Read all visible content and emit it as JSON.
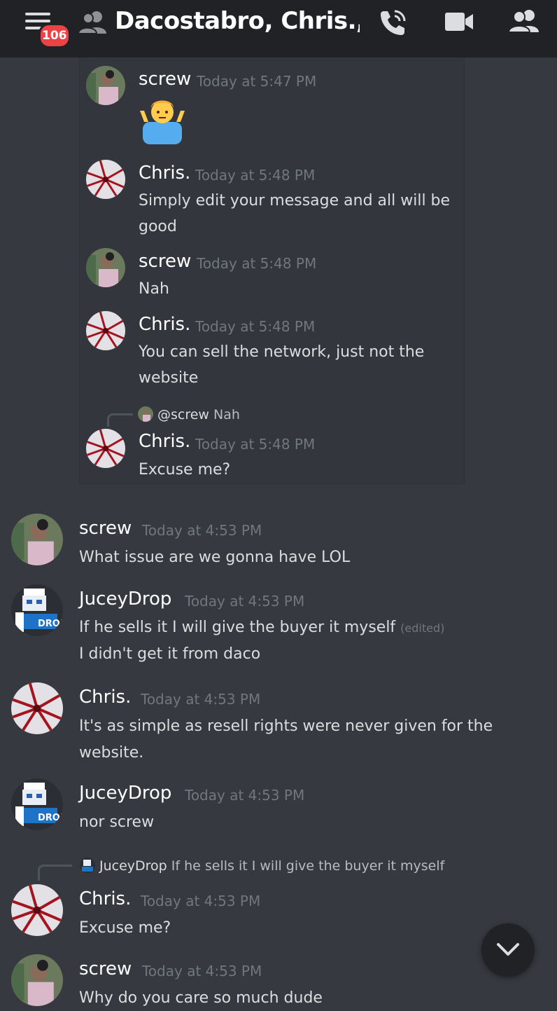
{
  "header": {
    "title": "Dacostabro, Chris.,...",
    "badge_count": "106",
    "icons": [
      "hamburger-menu-icon",
      "dm-group-icon",
      "voice-call-icon",
      "video-call-icon",
      "member-list-icon"
    ]
  },
  "thread_messages": [
    {
      "author": "screw",
      "time": "Today at 5:47 PM",
      "lines": [],
      "emoji": "man-shrugging-emoji"
    },
    {
      "author": "Chris.",
      "time": "Today at 5:48 PM",
      "lines": [
        "Simply edit your message and all will be",
        "good"
      ]
    },
    {
      "author": "screw",
      "time": "Today at 5:48 PM",
      "lines": [
        "Nah"
      ]
    },
    {
      "author": "Chris.",
      "time": "Today at 5:48 PM",
      "lines": [
        "You can sell the network, just not the",
        "website"
      ]
    },
    {
      "author": "Chris.",
      "time": "Today at 5:48 PM",
      "lines": [
        "Excuse me?"
      ],
      "reply": {
        "name": "@screw",
        "text": "Nah"
      }
    }
  ],
  "messages": [
    {
      "author": "screw",
      "time": "Today at 4:53 PM",
      "lines": [
        "What issue are we gonna have LOL"
      ]
    },
    {
      "author": "JuceyDrop",
      "time": "Today at 4:53 PM",
      "lines": [
        "If he sells it I will give the buyer it myself",
        "I didn't get it from daco"
      ],
      "edited": "(edited)"
    },
    {
      "author": "Chris.",
      "time": "Today at 4:53 PM",
      "lines": [
        "It's as simple as resell rights were never given for the",
        "website."
      ]
    },
    {
      "author": "JuceyDrop",
      "time": "Today at 4:53 PM",
      "lines": [
        "nor screw"
      ]
    },
    {
      "author": "Chris.",
      "time": "Today at 4:53 PM",
      "lines": [
        "Excuse me?"
      ],
      "reply": {
        "name": "JuceyDrop",
        "text": "If he sells it I will give the buyer it myself"
      }
    },
    {
      "author": "screw",
      "time": "Today at 4:53 PM",
      "lines": [
        "Why do you care so much dude"
      ]
    }
  ],
  "colors": {
    "background": "#36393f",
    "header": "#202225",
    "badge": "#ed4245",
    "timestamp": "#72767d"
  }
}
